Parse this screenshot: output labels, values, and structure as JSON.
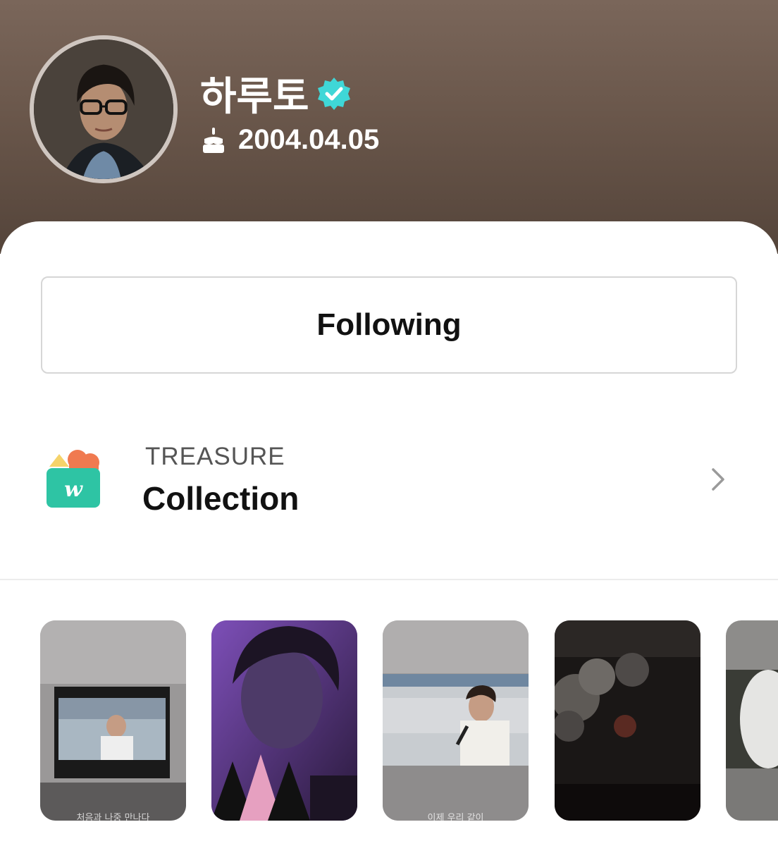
{
  "profile": {
    "name": "하루토",
    "birthday": "2004.04.05",
    "verified": true,
    "avatar_icon": "profile-photo",
    "birthday_icon": "cake-icon"
  },
  "follow_button": {
    "label": "Following"
  },
  "collection": {
    "group": "TREASURE",
    "title": "Collection",
    "icon": "weverse-collection-icon",
    "chevron": "chevron-right-icon"
  },
  "thumbnails": [
    {
      "caption": "처음과 나중 만나다",
      "theme": "tv-screen"
    },
    {
      "caption": "",
      "theme": "purple-portrait"
    },
    {
      "caption": "이제 우리 같이",
      "theme": "singer-mic"
    },
    {
      "caption": "",
      "theme": "night-blossom"
    },
    {
      "caption": "",
      "theme": "white-jacket"
    }
  ],
  "colors": {
    "header_top": "#7a665a",
    "header_bottom": "#54443a",
    "verified_badge": "#3fd7d7",
    "collection_green": "#2ec4a4",
    "collection_orange": "#f07a50"
  }
}
